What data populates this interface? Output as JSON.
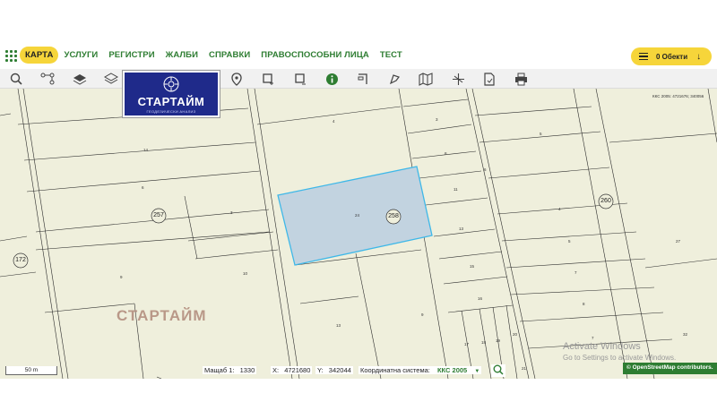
{
  "menu": {
    "items": [
      "КАРТА",
      "УСЛУГИ",
      "РЕГИСТРИ",
      "ЖАЛБИ",
      "СПРАВКИ",
      "ПРАВОСПОСОБНИ ЛИЦА",
      "ТЕСТ"
    ],
    "objects_button": "0 Обекти"
  },
  "logo": {
    "title": "СТАРТАЙМ",
    "subtitle": "ГЕОДЕЗИЧЕСКИ АНАЛИЗ"
  },
  "watermark": "СТАРТАЙМ",
  "map_labels": {
    "crs_corner": "ККС 2005: 4721676; 340056",
    "parcel_258": "258",
    "parcel_257": "257",
    "parcel_260": "260",
    "parcel_172": "172",
    "small": [
      "4",
      "14",
      "6",
      "3",
      "9",
      "10",
      "24",
      "13",
      "3",
      "8",
      "11",
      "13",
      "15",
      "16",
      "17",
      "18",
      "19",
      "20",
      "21",
      "5",
      "4",
      "5",
      "7",
      "8",
      "27",
      "6",
      "7",
      "9",
      "32"
    ]
  },
  "windows_watermark": {
    "line1": "Activate Windows",
    "line2": "Go to Settings to activate Windows."
  },
  "status": {
    "scale_label": "Мащаб 1:",
    "scale_value": "1330",
    "x_label": "X:",
    "x_value": "4721680",
    "y_label": "Y:",
    "y_value": "342044",
    "crs_label": "Координатна система:",
    "crs_value": "ККС 2005",
    "scalebar": "50 m"
  },
  "attribution": "© OpenStreetMap contributors.",
  "colors": {
    "brand_green": "#2e7d32",
    "accent_yellow": "#f6d53a",
    "map_bg": "#efefdc",
    "selection": "#3fb8e8"
  }
}
